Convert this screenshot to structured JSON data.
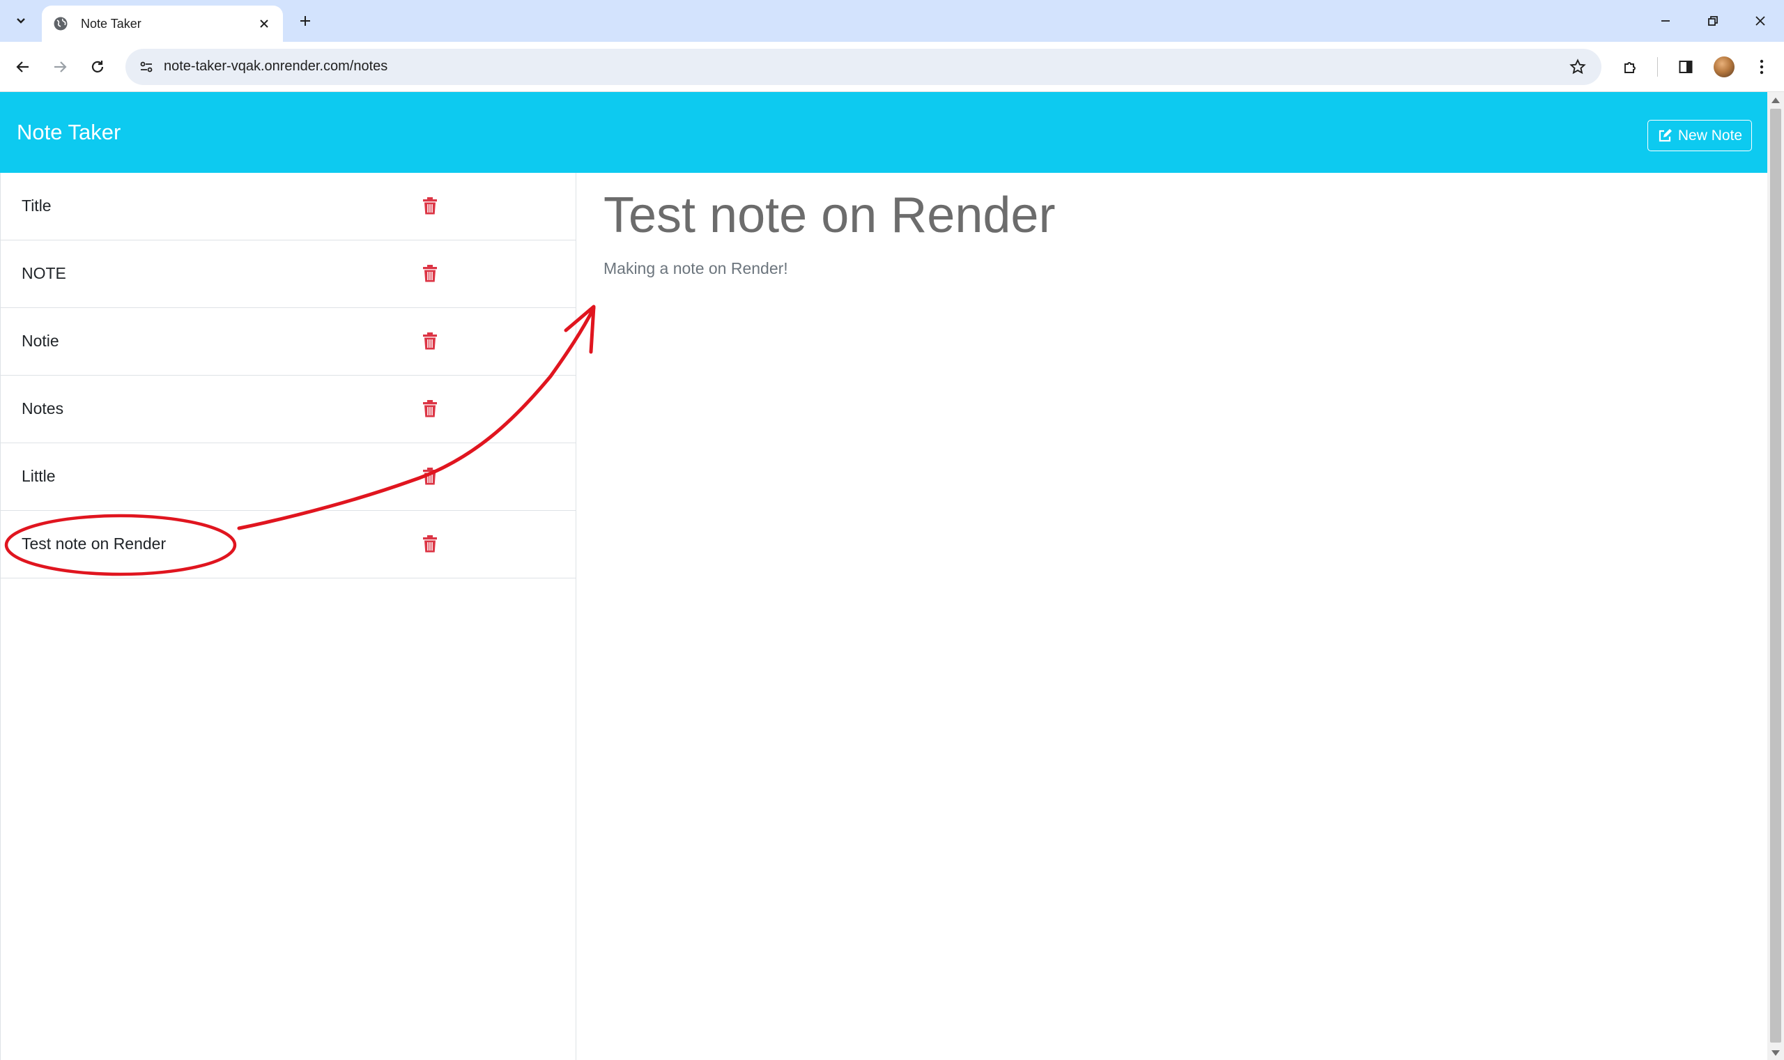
{
  "browser": {
    "tab_title": "Note Taker",
    "url": "note-taker-vqak.onrender.com/notes"
  },
  "app": {
    "brand": "Note Taker",
    "new_note_label": "New Note"
  },
  "notes": [
    {
      "title": "Title"
    },
    {
      "title": "NOTE"
    },
    {
      "title": "Notie"
    },
    {
      "title": "Notes"
    },
    {
      "title": "Little"
    },
    {
      "title": "Test note on Render"
    }
  ],
  "active_note": {
    "title": "Test note on Render",
    "text": "Making a note on Render!"
  },
  "colors": {
    "navbar": "#0dcaf0",
    "delete_icon": "#dc3545",
    "annotation": "#e0151f"
  },
  "icons": {
    "delete": "trash-icon",
    "new_note": "pencil-square-icon"
  }
}
